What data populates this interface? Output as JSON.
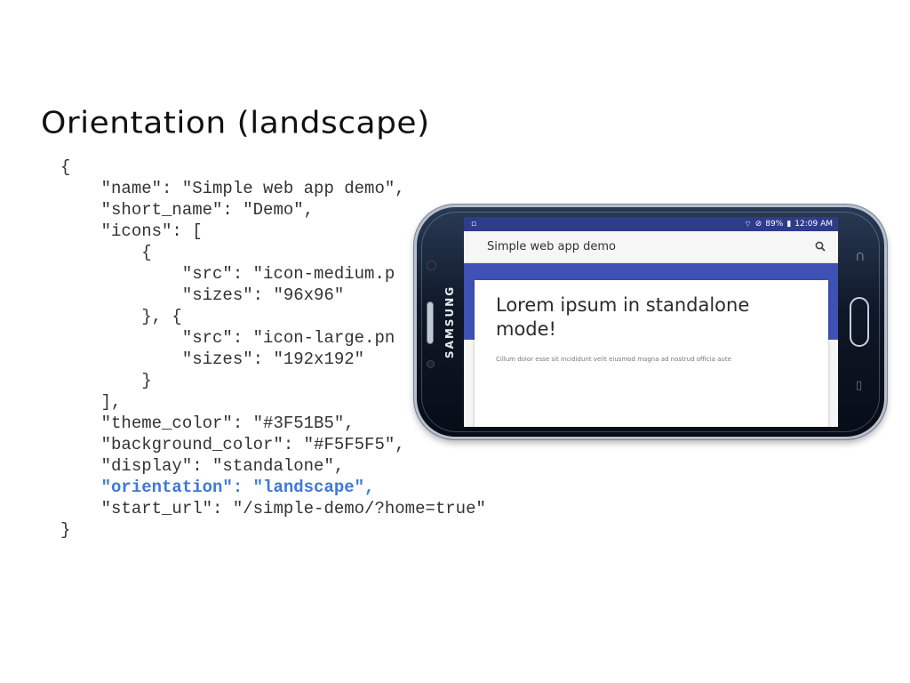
{
  "slide": {
    "title": "Orientation (landscape)"
  },
  "code": {
    "lines": [
      "{",
      "    \"name\": \"Simple web app demo\",",
      "    \"short_name\": \"Demo\",",
      "    \"icons\": [",
      "        {",
      "            \"src\": \"icon-medium.p",
      "            \"sizes\": \"96x96\"",
      "        }, {",
      "            \"src\": \"icon-large.pn",
      "            \"sizes\": \"192x192\"",
      "        }",
      "    ],",
      "    \"theme_color\": \"#3F51B5\",",
      "    \"background_color\": \"#F5F5F5\",",
      "    \"display\": \"standalone\",",
      "    \"orientation\": \"landscape\",",
      "    \"start_url\": \"/simple-demo/?home=true\"",
      "}"
    ],
    "highlight_line": "    \"orientation\": \"landscape\",",
    "highlight_color": "#3d79d9"
  },
  "phone": {
    "brand": "SAMSUNG",
    "status_bar": {
      "left_icon": "sd-card-icon",
      "battery": "89%",
      "time": "12:09 AM",
      "color": "#2e3c8a"
    },
    "app_bar": {
      "title": "Simple web app demo",
      "search_icon": "search-icon"
    },
    "theme_color": "#3F51B5",
    "card": {
      "heading": "Lorem ipsum in standalone mode!",
      "body": "Cillum dolor esse sit incididunt velit eiusmod magna ad nostrud officia aute"
    }
  }
}
